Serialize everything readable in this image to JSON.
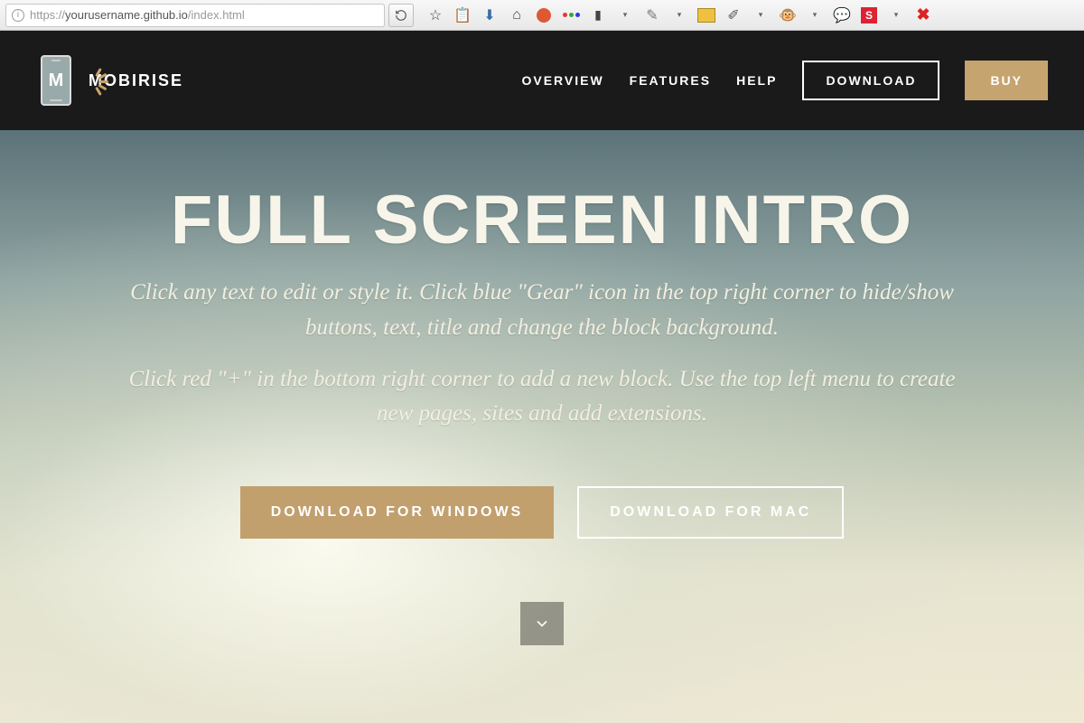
{
  "browser": {
    "url_prefix": "https://",
    "url_main": "yourusername.github.io",
    "url_suffix": "/index.html"
  },
  "header": {
    "brand": "MOBIRISE",
    "nav": {
      "overview": "OVERVIEW",
      "features": "FEATURES",
      "help": "HELP",
      "download": "DOWNLOAD",
      "buy": "BUY"
    }
  },
  "hero": {
    "title": "FULL SCREEN INTRO",
    "paragraph1": "Click any text to edit or style it. Click blue \"Gear\" icon in the top right corner to hide/show buttons, text, title and change the block background.",
    "paragraph2": "Click red \"+\" in the bottom right corner to add a new block. Use the top left menu to create new pages, sites and add extensions.",
    "btn_windows": "DOWNLOAD FOR WINDOWS",
    "btn_mac": "DOWNLOAD FOR MAC"
  },
  "colors": {
    "accent": "#c5a470",
    "header_bg": "#1a1a1a"
  }
}
